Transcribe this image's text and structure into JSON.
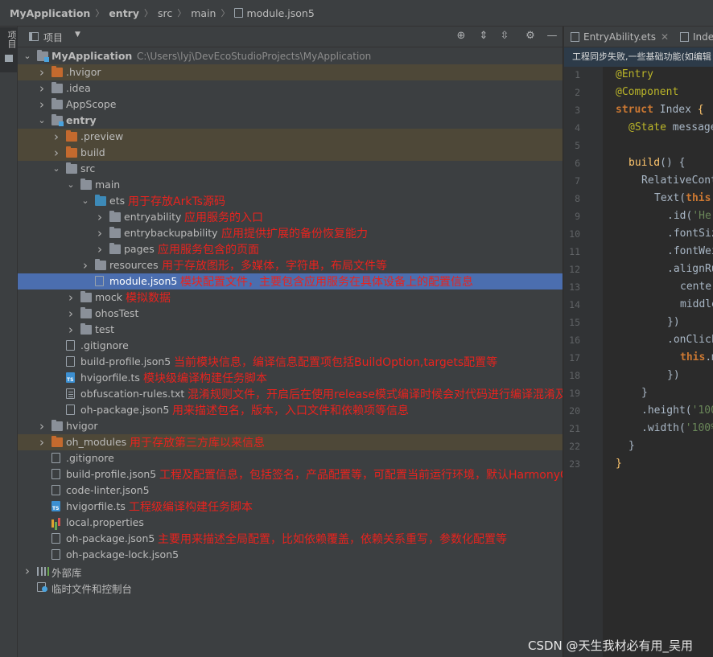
{
  "breadcrumb": [
    {
      "label": "MyApplication",
      "bold": true,
      "file": false
    },
    {
      "label": "entry",
      "bold": true,
      "file": false
    },
    {
      "label": "src",
      "bold": false,
      "file": false
    },
    {
      "label": "main",
      "bold": false,
      "file": false
    },
    {
      "label": "module.json5",
      "bold": false,
      "file": true
    }
  ],
  "stripe": {
    "label": "项目"
  },
  "project_panel": {
    "title": "项目",
    "dropdown": "▼"
  },
  "toolbar_icons": [
    "crosshair-icon",
    "expand-all-icon",
    "collapse-all-icon",
    "gear-icon",
    "minimize-icon"
  ],
  "tree": [
    {
      "depth": 0,
      "arrow": "down",
      "icon": "folder-module",
      "name": "MyApplication",
      "bold": true,
      "path": "C:\\Users\\lyj\\DevEcoStudioProjects\\MyApplication"
    },
    {
      "depth": 1,
      "arrow": "right",
      "icon": "folder-orange",
      "name": ".hvigor",
      "tint": true
    },
    {
      "depth": 1,
      "arrow": "right",
      "icon": "folder",
      "name": ".idea"
    },
    {
      "depth": 1,
      "arrow": "right",
      "icon": "folder",
      "name": "AppScope"
    },
    {
      "depth": 1,
      "arrow": "down",
      "icon": "folder-module",
      "name": "entry",
      "bold": true
    },
    {
      "depth": 2,
      "arrow": "right",
      "icon": "folder-orange",
      "name": ".preview",
      "tint": true
    },
    {
      "depth": 2,
      "arrow": "right",
      "icon": "folder-orange",
      "name": "build",
      "tint": true
    },
    {
      "depth": 2,
      "arrow": "down",
      "icon": "folder",
      "name": "src"
    },
    {
      "depth": 3,
      "arrow": "down",
      "icon": "folder",
      "name": "main"
    },
    {
      "depth": 4,
      "arrow": "down",
      "icon": "folder-blue",
      "name": "ets",
      "note": "用于存放ArkTs源码"
    },
    {
      "depth": 5,
      "arrow": "right",
      "icon": "folder",
      "name": "entryability",
      "note": "应用服务的入口"
    },
    {
      "depth": 5,
      "arrow": "right",
      "icon": "folder",
      "name": "entrybackupability",
      "note": "应用提供扩展的备份恢复能力"
    },
    {
      "depth": 5,
      "arrow": "right",
      "icon": "folder",
      "name": "pages",
      "note": "应用服务包含的页面"
    },
    {
      "depth": 4,
      "arrow": "right",
      "icon": "folder",
      "name": "resources",
      "note": "用于存放图形，多媒体，字符串，布局文件等"
    },
    {
      "depth": 4,
      "arrow": "none",
      "icon": "file",
      "name": "module.json5",
      "selected": true,
      "note": "模块配置文件，主要包含应用服务在具体设备上的配置信息"
    },
    {
      "depth": 3,
      "arrow": "right",
      "icon": "folder",
      "name": "mock",
      "note": "模拟数据"
    },
    {
      "depth": 3,
      "arrow": "right",
      "icon": "folder",
      "name": "ohosTest"
    },
    {
      "depth": 3,
      "arrow": "right",
      "icon": "folder",
      "name": "test"
    },
    {
      "depth": 2,
      "arrow": "none",
      "icon": "file",
      "name": ".gitignore"
    },
    {
      "depth": 2,
      "arrow": "none",
      "icon": "file",
      "name": "build-profile.json5",
      "note": "当前模块信息，编译信息配置项包括BuildOption,targets配置等"
    },
    {
      "depth": 2,
      "arrow": "none",
      "icon": "ts",
      "name": "hvigorfile.ts",
      "note": "模块级编译构建任务脚本"
    },
    {
      "depth": 2,
      "arrow": "none",
      "icon": "txt",
      "name": "obfuscation-rules.txt",
      "note": "混淆规则文件，开启后在使用release模式编译时候会对代码进行编译混淆及其压缩处理"
    },
    {
      "depth": 2,
      "arrow": "none",
      "icon": "file",
      "name": "oh-package.json5",
      "note": "用来描述包名，版本，入口文件和依赖项等信息"
    },
    {
      "depth": 1,
      "arrow": "right",
      "icon": "folder",
      "name": "hvigor"
    },
    {
      "depth": 1,
      "arrow": "right",
      "icon": "folder-orange",
      "name": "oh_modules",
      "tint": true,
      "note": "用于存放第三方库以来信息"
    },
    {
      "depth": 1,
      "arrow": "none",
      "icon": "file",
      "name": ".gitignore"
    },
    {
      "depth": 1,
      "arrow": "none",
      "icon": "file",
      "name": "build-profile.json5",
      "note": "工程及配置信息，包括签名，产品配置等，可配置当前运行环境，默认HarmonyOs"
    },
    {
      "depth": 1,
      "arrow": "none",
      "icon": "file",
      "name": "code-linter.json5"
    },
    {
      "depth": 1,
      "arrow": "none",
      "icon": "ts",
      "name": "hvigorfile.ts",
      "note": "工程级编译构建任务脚本"
    },
    {
      "depth": 1,
      "arrow": "none",
      "icon": "prop",
      "name": "local.properties"
    },
    {
      "depth": 1,
      "arrow": "none",
      "icon": "file",
      "name": "oh-package.json5",
      "note": "主要用来描述全局配置，比如依赖覆盖，依赖关系重写，参数化配置等"
    },
    {
      "depth": 1,
      "arrow": "none",
      "icon": "file",
      "name": "oh-package-lock.json5"
    },
    {
      "depth": 0,
      "arrow": "right",
      "icon": "lib",
      "name": "外部库"
    },
    {
      "depth": 0,
      "arrow": "none",
      "icon": "scratch",
      "name": "临时文件和控制台"
    }
  ],
  "editor": {
    "tabs": [
      {
        "label": "EntryAbility.ets",
        "close": "✕"
      },
      {
        "label": "Inde",
        "close": ""
      }
    ],
    "banner": "工程同步失败,一些基础功能(如编辑",
    "lines": [
      {
        "n": "1",
        "indent": 0,
        "tokens": [
          [
            "ann",
            "@Entry"
          ]
        ]
      },
      {
        "n": "2",
        "indent": 0,
        "tokens": [
          [
            "ann",
            "@Component"
          ]
        ]
      },
      {
        "n": "3",
        "indent": 0,
        "tokens": [
          [
            "kw",
            "struct "
          ],
          [
            "cls",
            "Index "
          ],
          [
            "fn",
            "{"
          ]
        ]
      },
      {
        "n": "4",
        "indent": 1,
        "tokens": [
          [
            "ann",
            "@State "
          ],
          [
            "plain",
            "message"
          ]
        ]
      },
      {
        "n": "5",
        "indent": 0,
        "tokens": []
      },
      {
        "n": "6",
        "indent": 1,
        "tokens": [
          [
            "fn",
            "build"
          ],
          [
            "plain",
            "() {"
          ]
        ]
      },
      {
        "n": "7",
        "indent": 2,
        "tokens": [
          [
            "plain",
            "RelativeCont"
          ]
        ]
      },
      {
        "n": "8",
        "indent": 3,
        "tokens": [
          [
            "plain",
            "Text("
          ],
          [
            "kw",
            "this"
          ]
        ]
      },
      {
        "n": "9",
        "indent": 4,
        "tokens": [
          [
            "meth",
            ".id("
          ],
          [
            "str",
            "'He"
          ]
        ]
      },
      {
        "n": "10",
        "indent": 4,
        "tokens": [
          [
            "meth",
            ".fontSiz"
          ]
        ]
      },
      {
        "n": "11",
        "indent": 4,
        "tokens": [
          [
            "meth",
            ".fontWei"
          ]
        ]
      },
      {
        "n": "12",
        "indent": 4,
        "tokens": [
          [
            "meth",
            ".alignRu"
          ]
        ]
      },
      {
        "n": "13",
        "indent": 5,
        "tokens": [
          [
            "plain",
            "center"
          ]
        ]
      },
      {
        "n": "14",
        "indent": 5,
        "tokens": [
          [
            "plain",
            "middle"
          ]
        ]
      },
      {
        "n": "15",
        "indent": 4,
        "tokens": [
          [
            "plain",
            "})"
          ]
        ]
      },
      {
        "n": "16",
        "indent": 4,
        "tokens": [
          [
            "meth",
            ".onClick"
          ]
        ]
      },
      {
        "n": "17",
        "indent": 5,
        "tokens": [
          [
            "kw",
            "this"
          ],
          [
            "plain",
            ".m"
          ]
        ]
      },
      {
        "n": "18",
        "indent": 4,
        "tokens": [
          [
            "plain",
            "})"
          ]
        ]
      },
      {
        "n": "19",
        "indent": 2,
        "tokens": [
          [
            "plain",
            "}"
          ]
        ]
      },
      {
        "n": "20",
        "indent": 2,
        "tokens": [
          [
            "meth",
            ".height("
          ],
          [
            "str",
            "'100"
          ]
        ]
      },
      {
        "n": "21",
        "indent": 2,
        "tokens": [
          [
            "meth",
            ".width("
          ],
          [
            "str",
            "'100%"
          ]
        ]
      },
      {
        "n": "22",
        "indent": 1,
        "tokens": [
          [
            "plain",
            "}"
          ]
        ]
      },
      {
        "n": "23",
        "indent": 0,
        "tokens": [
          [
            "fn",
            "}"
          ]
        ]
      }
    ]
  },
  "watermark": "CSDN @天生我材必有用_吴用"
}
